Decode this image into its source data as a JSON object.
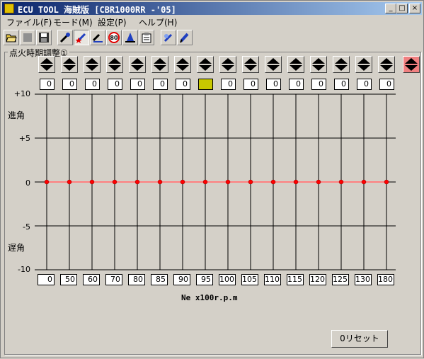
{
  "window": {
    "title": "ECU TOOL 海賊版 [CBR1000RR -'05]",
    "controls": [
      "_",
      "□",
      "×"
    ]
  },
  "menu": [
    "ファイル(F)",
    "モード(M)",
    "設定(P)",
    "ヘルプ(H)"
  ],
  "toolbar": {
    "tools": [
      "open-folder",
      "blank",
      "save",
      "wrench-edit",
      "wrench-star",
      "wrench-graph",
      "speed-limit",
      "cone",
      "clipboard",
      "tool-blue",
      "pencil"
    ],
    "speed_sign": "80"
  },
  "group": {
    "label": "点火時期調整①"
  },
  "y_axis": {
    "ticks": [
      "+10",
      "+5",
      "0",
      "-5",
      "-10"
    ],
    "advance_label": "進角",
    "retard_label": "遅角"
  },
  "x_axis": {
    "title": "Ne x100r.p.m"
  },
  "reset_button": "0リセット",
  "colors": {
    "line": "#ff8080",
    "point": "#ff0000",
    "selected_cell": "#c8c800",
    "active_arrow": "#f08080"
  },
  "chart_data": {
    "type": "line",
    "categories": [
      "0",
      "50",
      "60",
      "70",
      "80",
      "85",
      "90",
      "95",
      "100",
      "105",
      "110",
      "115",
      "120",
      "125",
      "130",
      "180"
    ],
    "values": [
      0,
      0,
      0,
      0,
      0,
      0,
      0,
      0,
      0,
      0,
      0,
      0,
      0,
      0,
      0,
      0
    ],
    "value_labels": [
      "0",
      "0",
      "0",
      "0",
      "0",
      "0",
      "0",
      "",
      "0",
      "0",
      "0",
      "0",
      "0",
      "0",
      "0",
      "0"
    ],
    "selected_index": 7,
    "ylim": [
      -10,
      10
    ],
    "xlabel": "Ne x100r.p.m",
    "grid": true
  }
}
